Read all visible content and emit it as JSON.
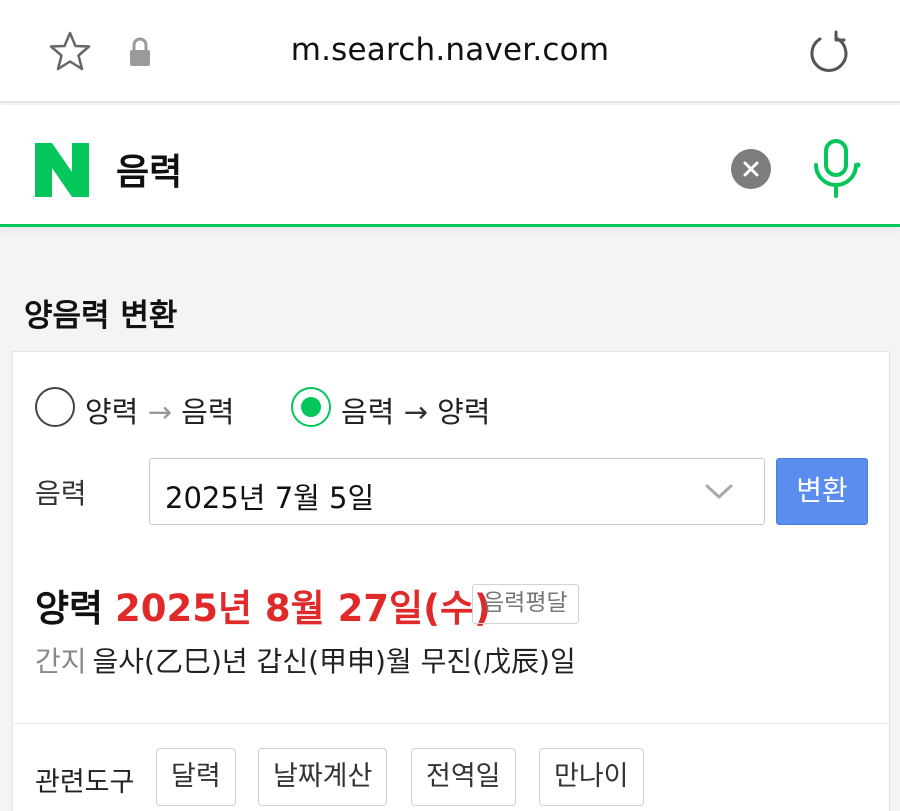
{
  "browser": {
    "url": "m.search.naver.com"
  },
  "search": {
    "query": "음력"
  },
  "converter": {
    "title": "양음력 변환",
    "radio_options": [
      {
        "from": "양력",
        "arrow": "→",
        "to": "음력",
        "selected": false
      },
      {
        "from": "음력",
        "arrow": "→",
        "to": "양력",
        "selected": true
      }
    ],
    "input_label": "음력",
    "selected_date": "2025년 7월 5일",
    "convert_button": "변환",
    "result": {
      "label": "양력",
      "date": "2025년 8월 27일(수)",
      "badge": "음력평달"
    },
    "ganji": {
      "label": "간지",
      "value": "을사(乙巳)년 갑신(甲申)월 무진(戊辰)일"
    },
    "related_tools": {
      "label": "관련도구",
      "items": [
        "달력",
        "날짜계산",
        "전역일",
        "만나이"
      ]
    }
  },
  "colors": {
    "naver_green": "#03c75a",
    "result_red": "#e02a2a",
    "button_blue": "#5b8def"
  }
}
